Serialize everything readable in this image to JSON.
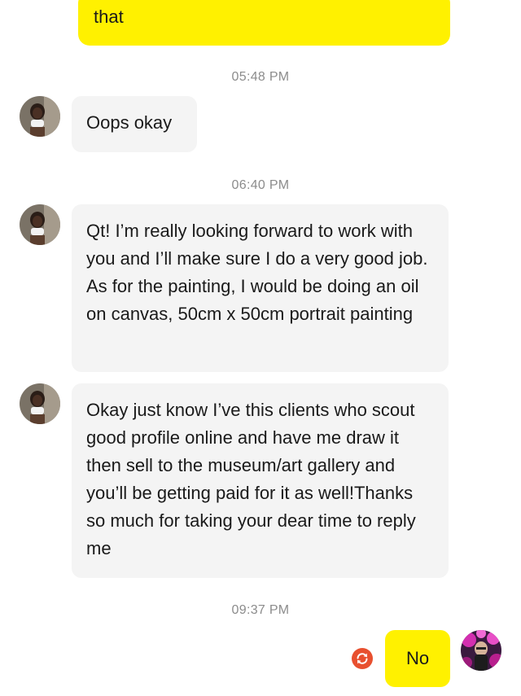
{
  "conversation": {
    "prev_outgoing": {
      "text": "that"
    },
    "messages": [
      {
        "time": "05:48 PM",
        "text": "Oops okay"
      },
      {
        "time": "06:40 PM",
        "text": "Qt! I’m really looking forward to work with you and I’ll make sure I do a very good job. As for the painting, I would be doing an oil on canvas, 50cm x 50cm portrait painting"
      },
      {
        "text": "Okay just know I’ve this clients who scout good profile online and have me draw it then sell to the museum/art gallery and you’ll be getting paid for it as well!Thanks so much for taking your dear time to reply me"
      }
    ],
    "last": {
      "time": "09:37 PM",
      "text": "No"
    }
  },
  "icons": {
    "retry": "refresh-icon",
    "avatar_contact": "contact-avatar",
    "avatar_self": "self-avatar"
  },
  "colors": {
    "outgoing_bubble": "#fff100",
    "incoming_bubble": "#f4f4f4",
    "timestamp": "#8c8c8c",
    "retry_icon": "#e8502f"
  }
}
